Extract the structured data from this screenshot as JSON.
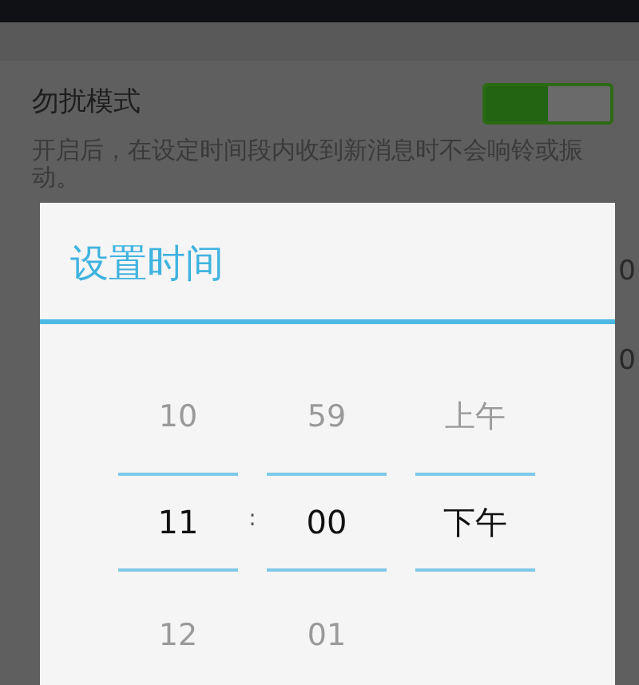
{
  "setting": {
    "title": "勿扰模式",
    "on": true,
    "description": "开启后，在设定时间段内收到新消息时不会响铃或振动。"
  },
  "rows_behind": [
    {
      "value": "0"
    },
    {
      "value": "0"
    }
  ],
  "dialog": {
    "title": "设置时间",
    "separator": ":",
    "columns": [
      {
        "above": "10",
        "value": "11",
        "below": "12"
      },
      {
        "above": "59",
        "value": "00",
        "below": "01"
      },
      {
        "above": "上午",
        "value": "下午"
      }
    ]
  }
}
